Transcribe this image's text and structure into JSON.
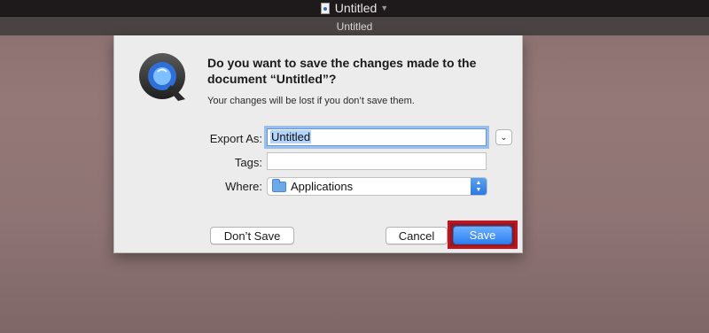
{
  "window": {
    "title": "Untitled",
    "tab_title": "Untitled"
  },
  "dialog": {
    "heading": "Do you want to save the changes made to the document “Untitled”?",
    "subtext": "Your changes will be lost if you don’t save them.",
    "export_as_label": "Export As:",
    "export_as_value": "Untitled",
    "tags_label": "Tags:",
    "tags_value": "",
    "where_label": "Where:",
    "where_value": "Applications",
    "dont_save_label": "Don’t Save",
    "cancel_label": "Cancel",
    "save_label": "Save"
  },
  "icons": {
    "app": "quicktime-icon",
    "document": "document-icon",
    "folder": "applications-folder-icon",
    "expand": "chevron-down-icon",
    "popup": "up-down-arrows-icon"
  },
  "colors": {
    "accent": "#2d7ff0",
    "highlight": "#c4131f",
    "focus_ring": "#5b9ae3"
  }
}
